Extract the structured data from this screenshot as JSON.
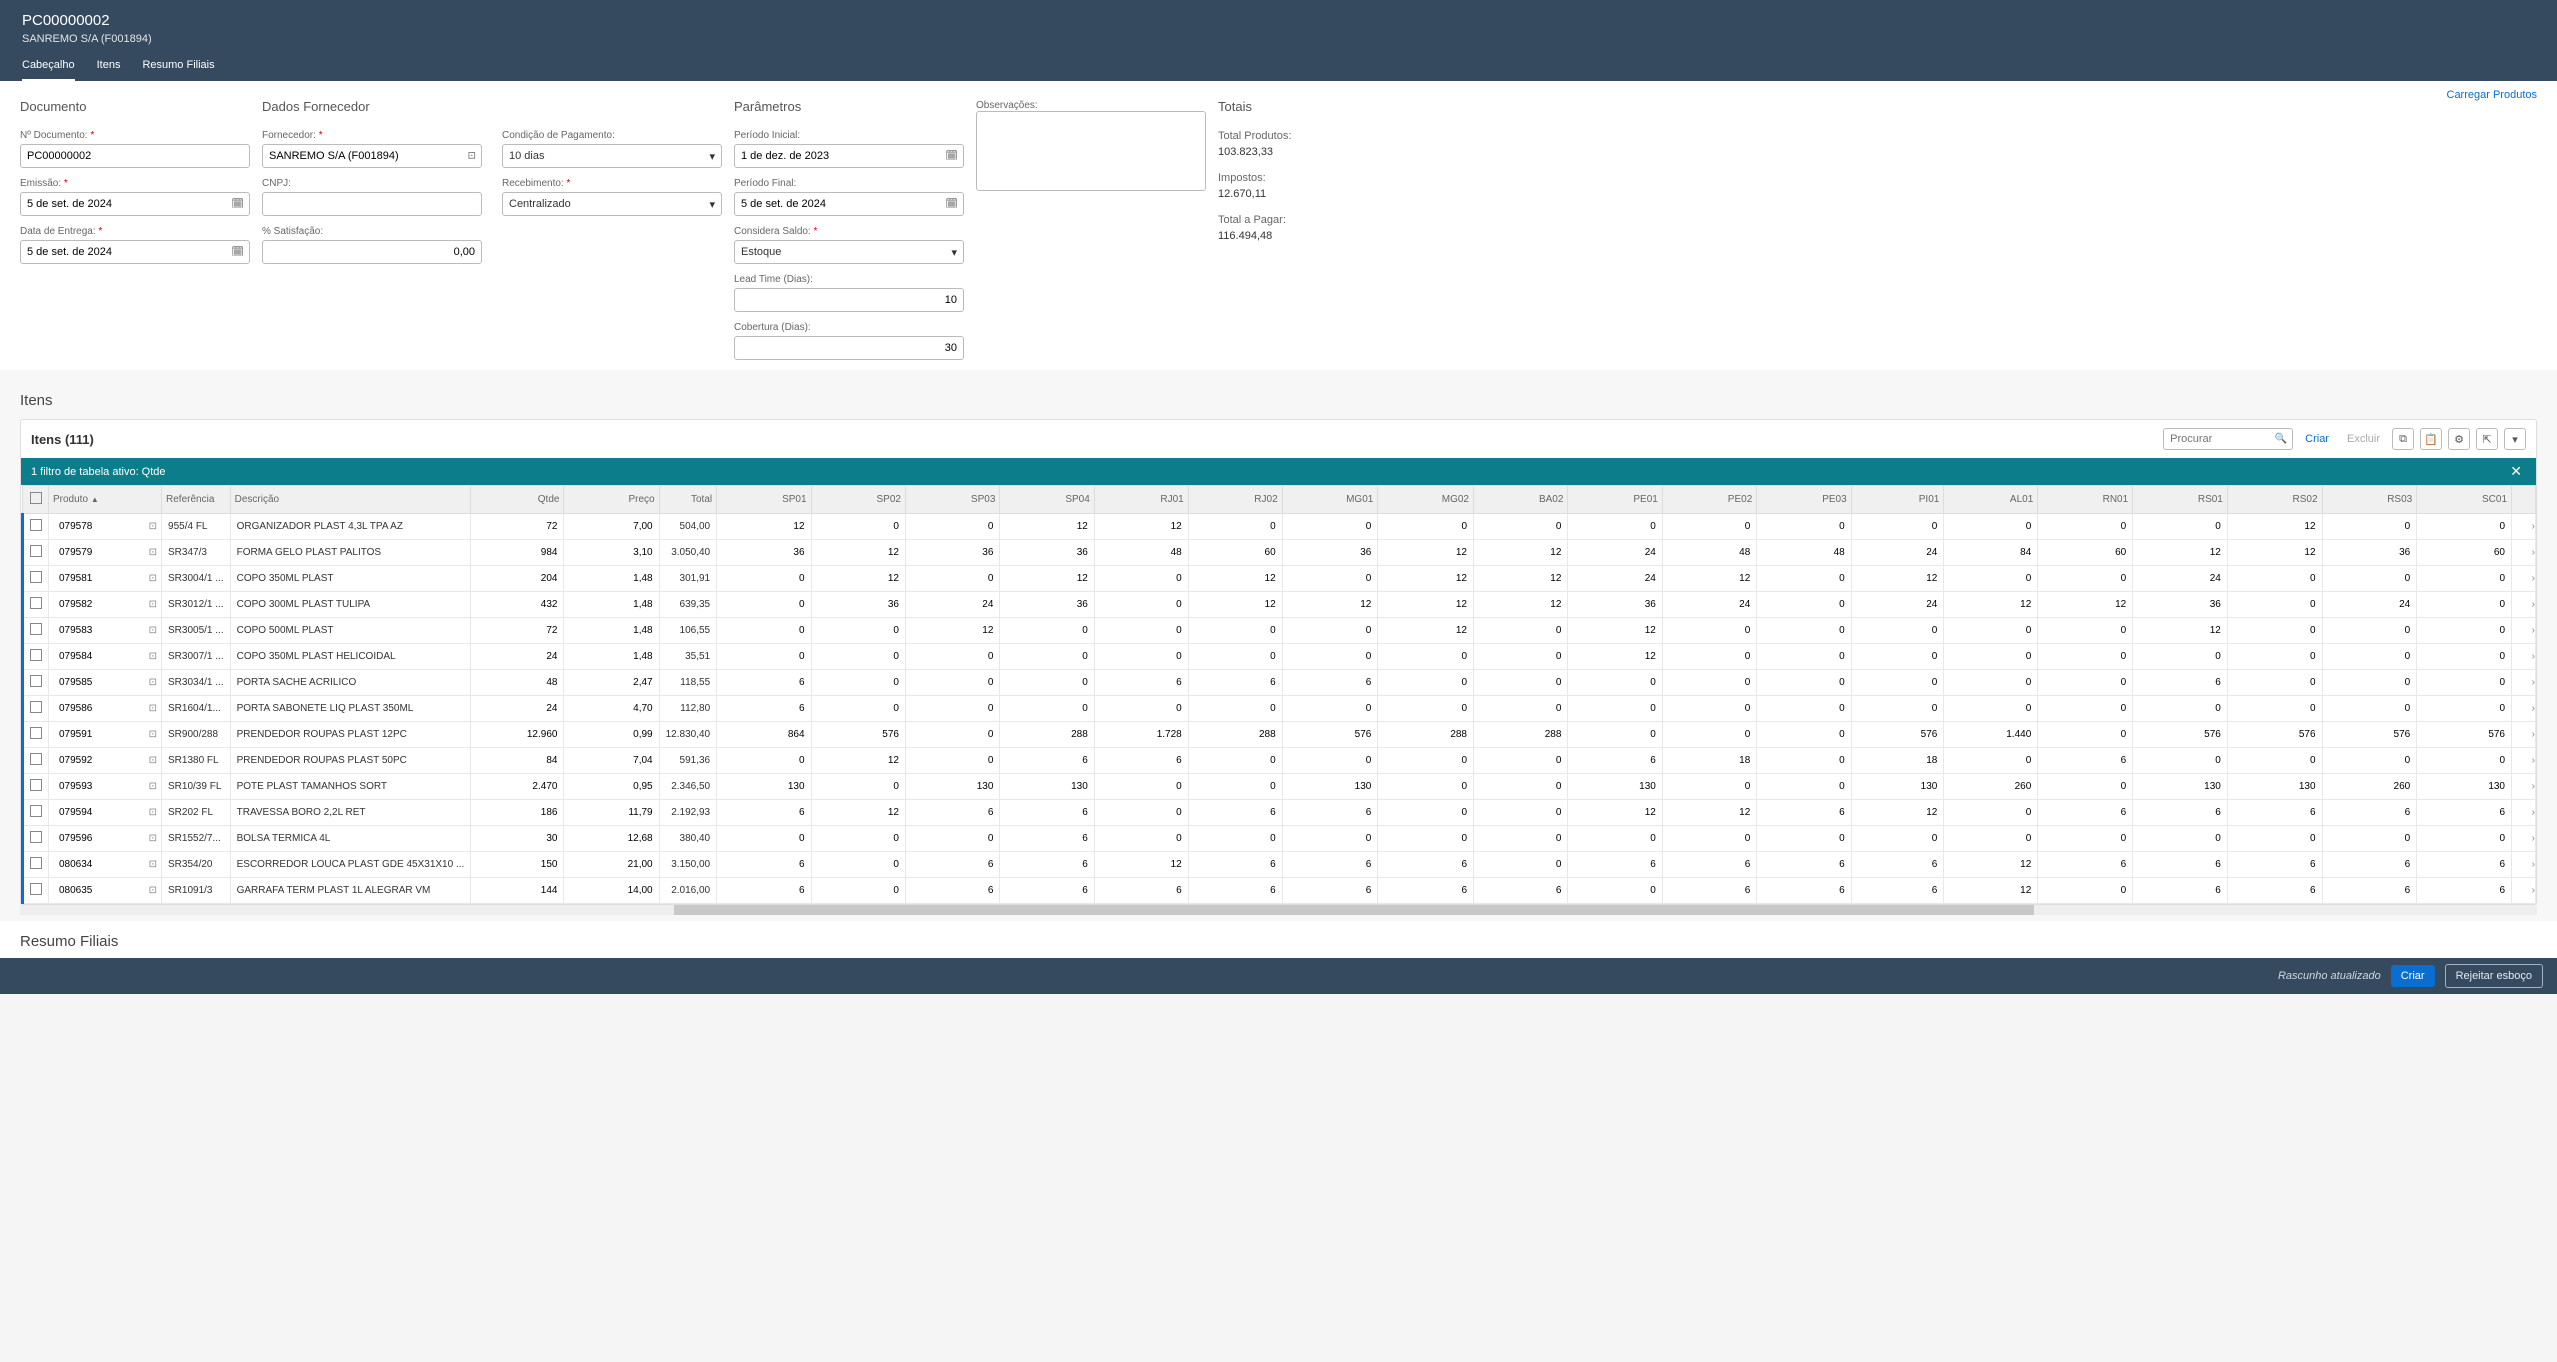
{
  "header": {
    "title": "PC00000002",
    "subtitle": "SANREMO S/A (F001894)",
    "tabs": [
      "Cabeçalho",
      "Itens",
      "Resumo Filiais"
    ],
    "activeTab": 0
  },
  "topLink": "Carregar Produtos",
  "documento": {
    "title": "Documento",
    "num_label": "Nº Documento:",
    "num": "PC00000002",
    "emissao_label": "Emissão:",
    "emissao": "5 de set. de 2024",
    "entrega_label": "Data de Entrega:",
    "entrega": "5 de set. de 2024"
  },
  "fornecedor": {
    "title": "Dados Fornecedor",
    "forn_label": "Fornecedor:",
    "forn": "SANREMO S/A (F001894)",
    "cnpj_label": "CNPJ:",
    "cnpj": "",
    "satisf_label": "% Satisfação:",
    "satisf": "0,00",
    "cond_label": "Condição de Pagamento:",
    "cond": "10 dias",
    "receb_label": "Recebimento:",
    "receb": "Centralizado"
  },
  "parametros": {
    "title": "Parâmetros",
    "pi_label": "Período Inicial:",
    "pi": "1 de dez. de 2023",
    "pf_label": "Período Final:",
    "pf": "5 de set. de 2024",
    "saldo_label": "Considera Saldo:",
    "saldo": "Estoque",
    "lead_label": "Lead Time (Dias):",
    "lead": "10",
    "cob_label": "Cobertura (Dias):",
    "cob": "30"
  },
  "obs": {
    "label": "Observações:",
    "value": ""
  },
  "totais": {
    "title": "Totais",
    "tp_label": "Total Produtos:",
    "tp": "103.823,33",
    "imp_label": "Impostos:",
    "imp": "12.670,11",
    "pag_label": "Total a Pagar:",
    "pag": "116.494,48"
  },
  "itensTitle": "Itens",
  "itensCount": "Itens (111)",
  "search_ph": "Procurar",
  "btn_criar": "Criar",
  "btn_excluir": "Excluir",
  "filter_text": "1 filtro de tabela ativo: Qtde",
  "cols": [
    "Produto",
    "Referência",
    "Descrição",
    "Qtde",
    "Preço",
    "Total",
    "SP01",
    "SP02",
    "SP03",
    "SP04",
    "RJ01",
    "RJ02",
    "MG01",
    "MG02",
    "BA02",
    "PE01",
    "PE02",
    "PE03",
    "PI01",
    "AL01",
    "RN01",
    "RS01",
    "RS02",
    "RS03",
    "SC01"
  ],
  "rows": [
    {
      "p": "079578",
      "r": "955/4 FL",
      "d": "ORGANIZADOR PLAST 4,3L TPA AZ",
      "q": "72",
      "pr": "7,00",
      "t": "504,00",
      "v": [
        "12",
        "0",
        "0",
        "12",
        "12",
        "0",
        "0",
        "0",
        "0",
        "0",
        "0",
        "0",
        "0",
        "0",
        "0",
        "0",
        "12",
        "0",
        "0"
      ]
    },
    {
      "p": "079579",
      "r": "SR347/3",
      "d": "FORMA GELO PLAST PALITOS",
      "q": "984",
      "pr": "3,10",
      "t": "3.050,40",
      "v": [
        "36",
        "12",
        "36",
        "36",
        "48",
        "60",
        "36",
        "12",
        "12",
        "24",
        "48",
        "48",
        "24",
        "84",
        "60",
        "12",
        "12",
        "36",
        "60"
      ]
    },
    {
      "p": "079581",
      "r": "SR3004/1 ...",
      "d": "COPO 350ML PLAST",
      "q": "204",
      "pr": "1,48",
      "t": "301,91",
      "v": [
        "0",
        "12",
        "0",
        "12",
        "0",
        "12",
        "0",
        "12",
        "12",
        "24",
        "12",
        "0",
        "12",
        "0",
        "0",
        "24",
        "0",
        "0",
        "0"
      ]
    },
    {
      "p": "079582",
      "r": "SR3012/1 ...",
      "d": "COPO 300ML PLAST TULIPA",
      "q": "432",
      "pr": "1,48",
      "t": "639,35",
      "v": [
        "0",
        "36",
        "24",
        "36",
        "0",
        "12",
        "12",
        "12",
        "12",
        "36",
        "24",
        "0",
        "24",
        "12",
        "12",
        "36",
        "0",
        "24",
        "0"
      ]
    },
    {
      "p": "079583",
      "r": "SR3005/1 ...",
      "d": "COPO 500ML PLAST",
      "q": "72",
      "pr": "1,48",
      "t": "106,55",
      "v": [
        "0",
        "0",
        "12",
        "0",
        "0",
        "0",
        "0",
        "12",
        "0",
        "12",
        "0",
        "0",
        "0",
        "0",
        "0",
        "12",
        "0",
        "0",
        "0"
      ]
    },
    {
      "p": "079584",
      "r": "SR3007/1 ...",
      "d": "COPO 350ML PLAST HELICOIDAL",
      "q": "24",
      "pr": "1,48",
      "t": "35,51",
      "v": [
        "0",
        "0",
        "0",
        "0",
        "0",
        "0",
        "0",
        "0",
        "0",
        "12",
        "0",
        "0",
        "0",
        "0",
        "0",
        "0",
        "0",
        "0",
        "0"
      ]
    },
    {
      "p": "079585",
      "r": "SR3034/1 ...",
      "d": "PORTA SACHE ACRILICO",
      "q": "48",
      "pr": "2,47",
      "t": "118,55",
      "v": [
        "6",
        "0",
        "0",
        "0",
        "6",
        "6",
        "6",
        "0",
        "0",
        "0",
        "0",
        "0",
        "0",
        "0",
        "0",
        "6",
        "0",
        "0",
        "0"
      ]
    },
    {
      "p": "079586",
      "r": "SR1604/1...",
      "d": "PORTA SABONETE LIQ PLAST 350ML",
      "q": "24",
      "pr": "4,70",
      "t": "112,80",
      "v": [
        "6",
        "0",
        "0",
        "0",
        "0",
        "0",
        "0",
        "0",
        "0",
        "0",
        "0",
        "0",
        "0",
        "0",
        "0",
        "0",
        "0",
        "0",
        "0"
      ]
    },
    {
      "p": "079591",
      "r": "SR900/288",
      "d": "PRENDEDOR ROUPAS PLAST 12PC",
      "q": "12.960",
      "pr": "0,99",
      "t": "12.830,40",
      "v": [
        "864",
        "576",
        "0",
        "288",
        "1.728",
        "288",
        "576",
        "288",
        "288",
        "0",
        "0",
        "0",
        "576",
        "1.440",
        "0",
        "576",
        "576",
        "576",
        "576"
      ]
    },
    {
      "p": "079592",
      "r": "SR1380 FL",
      "d": "PRENDEDOR ROUPAS PLAST 50PC",
      "q": "84",
      "pr": "7,04",
      "t": "591,36",
      "v": [
        "0",
        "12",
        "0",
        "6",
        "6",
        "0",
        "0",
        "0",
        "0",
        "6",
        "18",
        "0",
        "18",
        "0",
        "6",
        "0",
        "0",
        "0",
        "0"
      ]
    },
    {
      "p": "079593",
      "r": "SR10/39 FL",
      "d": "POTE PLAST TAMANHOS SORT",
      "q": "2.470",
      "pr": "0,95",
      "t": "2.346,50",
      "v": [
        "130",
        "0",
        "130",
        "130",
        "0",
        "0",
        "130",
        "0",
        "0",
        "130",
        "0",
        "0",
        "130",
        "260",
        "0",
        "130",
        "130",
        "260",
        "130"
      ]
    },
    {
      "p": "079594",
      "r": "SR202 FL",
      "d": "TRAVESSA BORO 2,2L RET",
      "q": "186",
      "pr": "11,79",
      "t": "2.192,93",
      "v": [
        "6",
        "12",
        "6",
        "6",
        "0",
        "6",
        "6",
        "0",
        "0",
        "12",
        "12",
        "6",
        "12",
        "0",
        "6",
        "6",
        "6",
        "6",
        "6"
      ]
    },
    {
      "p": "079596",
      "r": "SR1552/7...",
      "d": "BOLSA TERMICA 4L",
      "q": "30",
      "pr": "12,68",
      "t": "380,40",
      "v": [
        "0",
        "0",
        "0",
        "6",
        "0",
        "0",
        "0",
        "0",
        "0",
        "0",
        "0",
        "0",
        "0",
        "0",
        "0",
        "0",
        "0",
        "0",
        "0"
      ]
    },
    {
      "p": "080634",
      "r": "SR354/20",
      "d": "ESCORREDOR LOUCA PLAST GDE 45X31X10 ...",
      "q": "150",
      "pr": "21,00",
      "t": "3.150,00",
      "v": [
        "6",
        "0",
        "6",
        "6",
        "12",
        "6",
        "6",
        "6",
        "0",
        "6",
        "6",
        "6",
        "6",
        "12",
        "6",
        "6",
        "6",
        "6",
        "6"
      ]
    },
    {
      "p": "080635",
      "r": "SR1091/3",
      "d": "GARRAFA TERM PLAST 1L ALEGRAR VM",
      "q": "144",
      "pr": "14,00",
      "t": "2.016,00",
      "v": [
        "6",
        "0",
        "6",
        "6",
        "6",
        "6",
        "6",
        "6",
        "6",
        "0",
        "6",
        "6",
        "6",
        "12",
        "0",
        "6",
        "6",
        "6",
        "6"
      ]
    }
  ],
  "resumo_title": "Resumo Filiais",
  "footer": {
    "draft": "Rascunho atualizado",
    "criar": "Criar",
    "rejeitar": "Rejeitar esboço"
  }
}
